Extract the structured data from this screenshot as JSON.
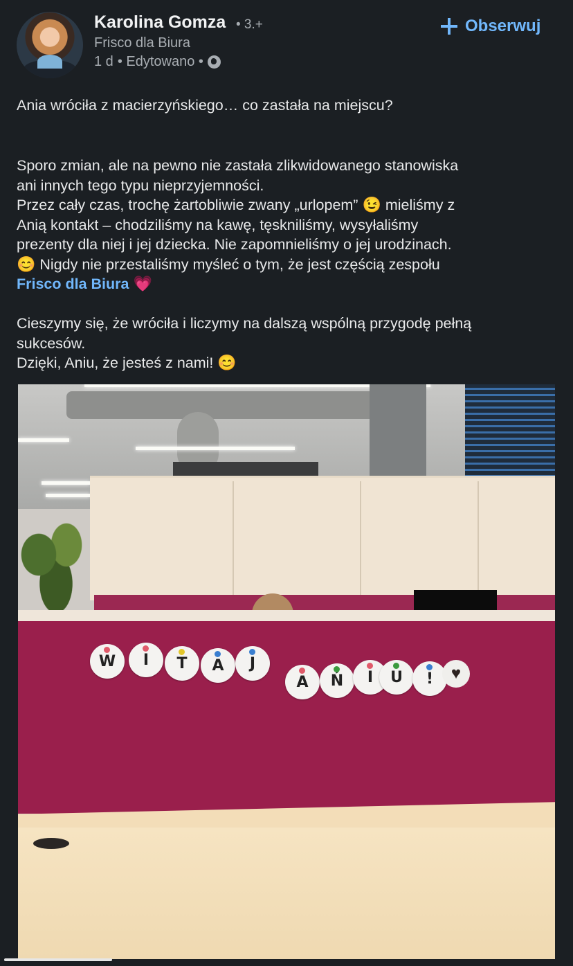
{
  "author": {
    "name": "Karolina Gomza",
    "degree": "• 3.+",
    "company": "Frisco dla Biura",
    "time": "1 d",
    "edited": "• Edytowano •",
    "visibility_icon": "globe-icon"
  },
  "follow_button": {
    "label": "Obserwuj",
    "icon": "plus-icon"
  },
  "post": {
    "line1": "Ania wróciła z macierzyńskiego… co zastała na miejscu?",
    "p2_line1": "Sporo zmian, ale na pewno nie zastała zlikwidowanego stanowiska",
    "p2_line2": "ani innych tego typu nieprzyjemności.",
    "p3_line1a": "Przez cały czas, trochę żartobliwie zwany „urlopem”",
    "emoji_wink": "😉",
    "p3_line1b": "mieliśmy z",
    "p3_line2": "Anią kontakt – chodziliśmy na kawę, tęskniliśmy, wysyłaliśmy",
    "p3_line3": "prezenty dla niej i jej dziecka. Nie zapomnieliśmy o jej urodzinach.",
    "emoji_smile1": "😊",
    "p3_line4": "Nigdy nie przestaliśmy myśleć o tym, że jest częścią zespołu",
    "mention": "Frisco dla Biura",
    "emoji_heart": "💗",
    "p4_line1": "Cieszymy się, że wróciła i liczymy na dalszą wspólną przygodę pełną",
    "p4_line2": "sukcesów.",
    "p5_line1": "Dzięki, Aniu, że jesteś z nami!",
    "emoji_smile2": "😊"
  },
  "photo": {
    "letters_row1": [
      "W",
      "I",
      "T",
      "A",
      "J"
    ],
    "letters_row2": [
      "A",
      "Ń",
      "I",
      "U",
      "!"
    ],
    "heart_glyph": "♥"
  },
  "colors": {
    "background": "#1b1f23",
    "link": "#71b7fb",
    "partition": "#9a1f4c"
  }
}
